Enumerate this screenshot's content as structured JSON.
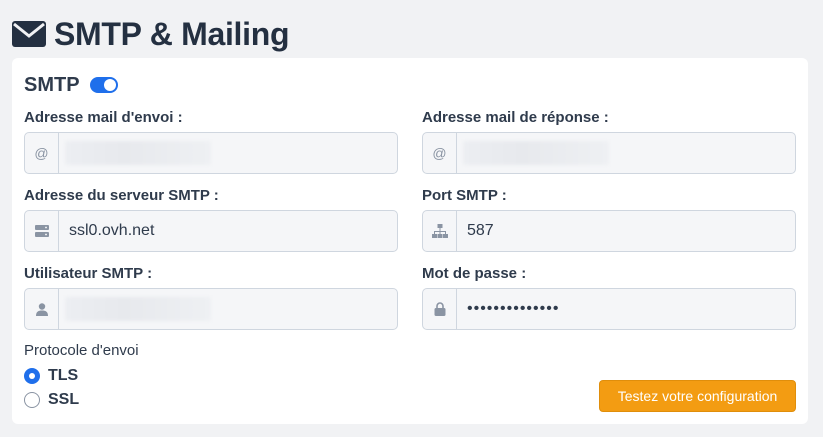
{
  "page": {
    "title": "SMTP & Mailing",
    "icon": "envelope-icon"
  },
  "smtp": {
    "label": "SMTP",
    "enabled": true
  },
  "fields": {
    "sender_email": {
      "label": "Adresse mail d'envoi :",
      "value": "",
      "icon": "at-icon"
    },
    "reply_email": {
      "label": "Adresse mail de réponse :",
      "value": "",
      "icon": "at-icon"
    },
    "smtp_server": {
      "label": "Adresse du serveur SMTP :",
      "value": "ssl0.ovh.net",
      "icon": "server-icon"
    },
    "smtp_port": {
      "label": "Port SMTP :",
      "value": "587",
      "icon": "network-icon"
    },
    "smtp_user": {
      "label": "Utilisateur SMTP :",
      "value": "",
      "icon": "user-icon"
    },
    "password": {
      "label": "Mot de passe :",
      "value": "••••••••••••••",
      "icon": "lock-icon"
    }
  },
  "protocol": {
    "title": "Protocole d'envoi",
    "options": [
      "TLS",
      "SSL"
    ],
    "selected": "TLS"
  },
  "actions": {
    "test_button": "Testez votre configuration"
  },
  "colors": {
    "accent": "#1f6feb",
    "button": "#f39c12",
    "background": "#f1f2f4"
  }
}
